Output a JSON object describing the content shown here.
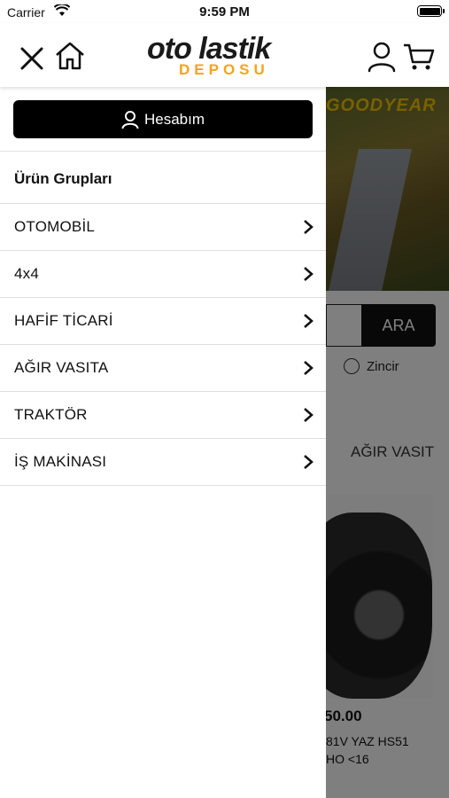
{
  "status_bar": {
    "carrier": "Carrier",
    "time": "9:59 PM"
  },
  "header": {
    "logo_main": "oto lastik",
    "logo_sub": "DEPOSU",
    "icons": [
      "close-icon",
      "home-icon",
      "user-icon",
      "cart-icon"
    ]
  },
  "drawer": {
    "account_label": "Hesabım",
    "section_title": "Ürün Grupları",
    "items": [
      {
        "label": "OTOMOBİL"
      },
      {
        "label": "4x4"
      },
      {
        "label": "HAFİF TİCARİ"
      },
      {
        "label": "AĞIR VASITA"
      },
      {
        "label": "TRAKTÖR"
      },
      {
        "label": "İŞ MAKİNASI"
      }
    ]
  },
  "background_page": {
    "banner_brand": "GOODYEAR",
    "search_button": "ARA",
    "chain_option": "Zincir",
    "category_tab": "AĞIR VASIT",
    "tire_price": "50.00",
    "tire_desc_line1": "81V YAZ HS51",
    "tire_desc_line2": "HO <16"
  },
  "colors": {
    "accent": "#f5a31a",
    "button_bg": "#000000",
    "overlay": "rgba(0,0,0,0.5)"
  }
}
